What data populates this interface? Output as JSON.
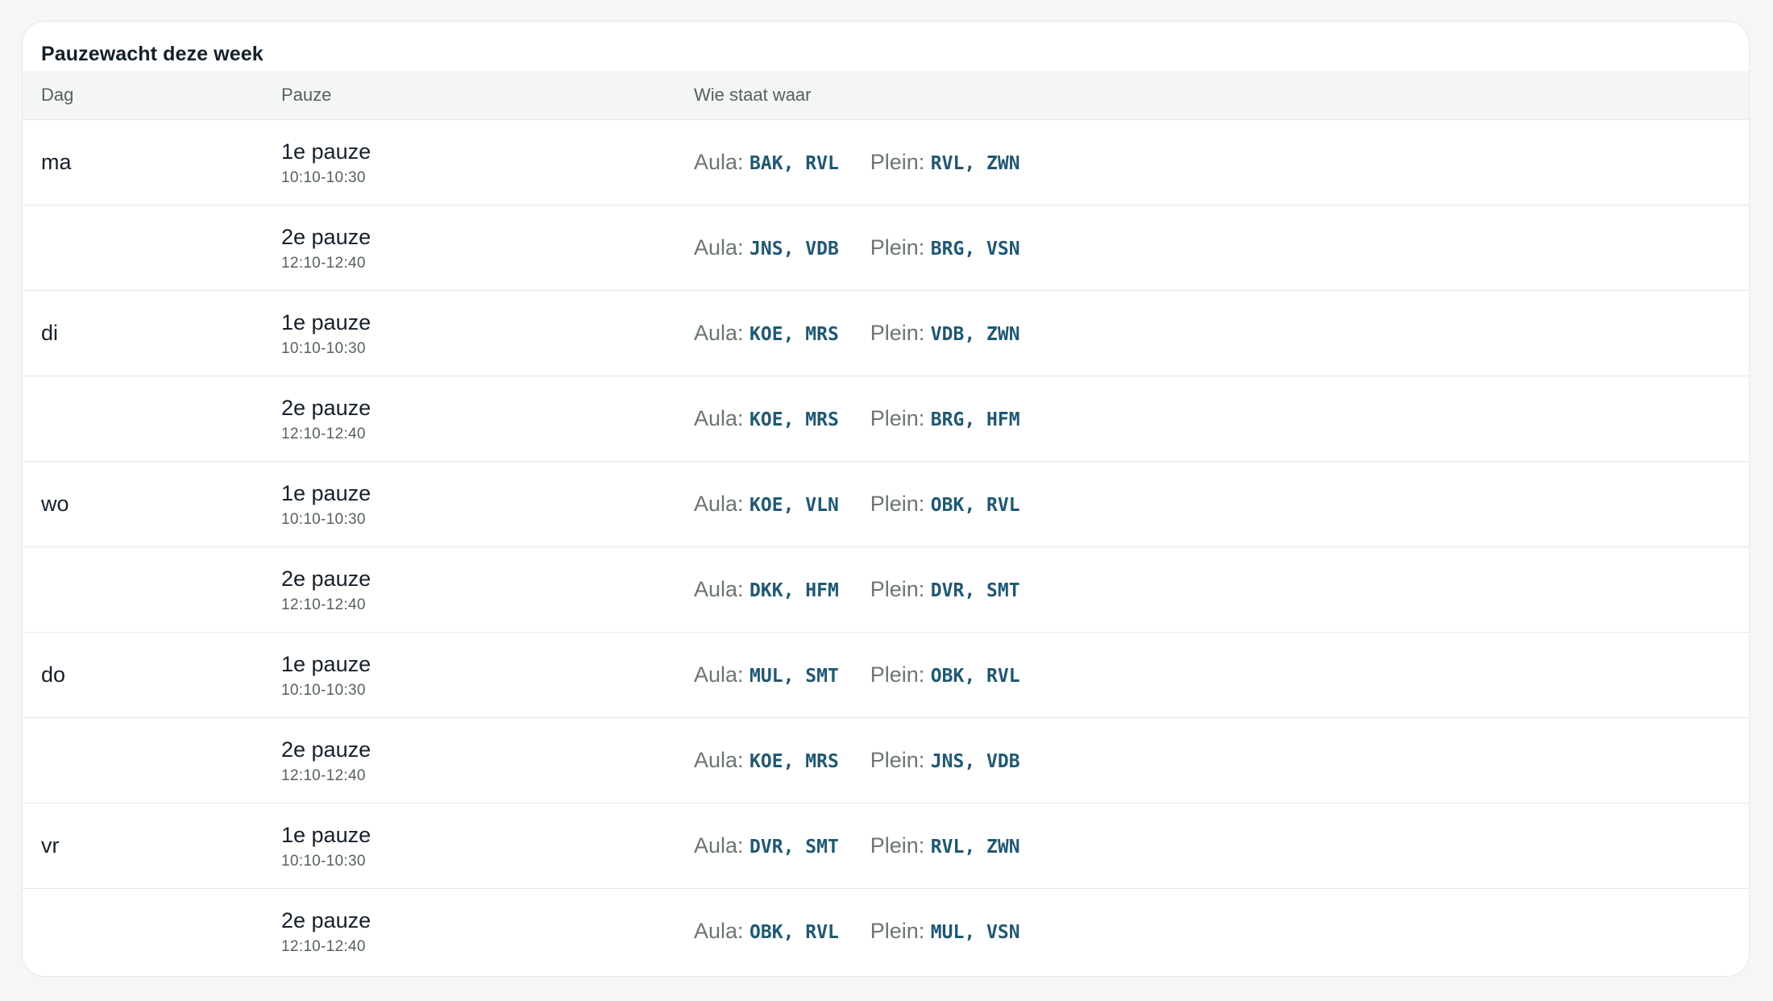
{
  "card": {
    "title": "Pauzewacht deze week"
  },
  "table": {
    "headers": {
      "dag": "Dag",
      "pauze": "Pauze",
      "wie": "Wie staat waar"
    },
    "rows": [
      {
        "dag": "ma",
        "pauze": "1e pauze",
        "tijd": "10:10-10:30",
        "aula_label": "Aula:",
        "aula": "BAK, RVL",
        "plein_label": "Plein:",
        "plein": "RVL, ZWN"
      },
      {
        "dag": "",
        "pauze": "2e pauze",
        "tijd": "12:10-12:40",
        "aula_label": "Aula:",
        "aula": "JNS, VDB",
        "plein_label": "Plein:",
        "plein": "BRG, VSN"
      },
      {
        "dag": "di",
        "pauze": "1e pauze",
        "tijd": "10:10-10:30",
        "aula_label": "Aula:",
        "aula": "KOE, MRS",
        "plein_label": "Plein:",
        "plein": "VDB, ZWN"
      },
      {
        "dag": "",
        "pauze": "2e pauze",
        "tijd": "12:10-12:40",
        "aula_label": "Aula:",
        "aula": "KOE, MRS",
        "plein_label": "Plein:",
        "plein": "BRG, HFM"
      },
      {
        "dag": "wo",
        "pauze": "1e pauze",
        "tijd": "10:10-10:30",
        "aula_label": "Aula:",
        "aula": "KOE, VLN",
        "plein_label": "Plein:",
        "plein": "OBK, RVL"
      },
      {
        "dag": "",
        "pauze": "2e pauze",
        "tijd": "12:10-12:40",
        "aula_label": "Aula:",
        "aula": "DKK, HFM",
        "plein_label": "Plein:",
        "plein": "DVR, SMT"
      },
      {
        "dag": "do",
        "pauze": "1e pauze",
        "tijd": "10:10-10:30",
        "aula_label": "Aula:",
        "aula": "MUL, SMT",
        "plein_label": "Plein:",
        "plein": "OBK, RVL"
      },
      {
        "dag": "",
        "pauze": "2e pauze",
        "tijd": "12:10-12:40",
        "aula_label": "Aula:",
        "aula": "KOE, MRS",
        "plein_label": "Plein:",
        "plein": "JNS, VDB"
      },
      {
        "dag": "vr",
        "pauze": "1e pauze",
        "tijd": "10:10-10:30",
        "aula_label": "Aula:",
        "aula": "DVR, SMT",
        "plein_label": "Plein:",
        "plein": "RVL, ZWN"
      },
      {
        "dag": "",
        "pauze": "2e pauze",
        "tijd": "12:10-12:40",
        "aula_label": "Aula:",
        "aula": "OBK, RVL",
        "plein_label": "Plein:",
        "plein": "MUL, VSN"
      }
    ]
  },
  "colors": {
    "accent_codes": "#1f5873",
    "muted": "#56615c",
    "text": "#15202b"
  }
}
